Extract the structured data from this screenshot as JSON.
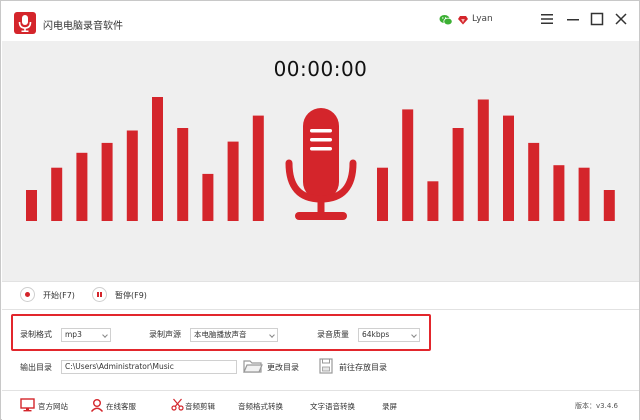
{
  "app": {
    "title": "闪电电脑录音软件",
    "user": "Lyan",
    "accent_color": "#d4252b",
    "icons": {
      "logo": "microphone-icon",
      "wechat": "wechat-icon",
      "vip": "diamond-icon",
      "menu": "hamburger-menu-icon",
      "minimize": "minimize-icon",
      "maximize": "maximize-icon",
      "close": "close-icon"
    }
  },
  "recorder": {
    "timer": "00:00:00",
    "level_bars_left": [
      0.25,
      0.43,
      0.55,
      0.63,
      0.73,
      1.0,
      0.75,
      0.38,
      0.64,
      0.85
    ],
    "level_bars_right": [
      0.43,
      0.9,
      0.32,
      0.75,
      0.98,
      0.85,
      0.63,
      0.45,
      0.43,
      0.25
    ]
  },
  "controls": {
    "start_label": "开始(F7)",
    "pause_label": "暂停(F9)"
  },
  "settings": {
    "format_label": "录制格式",
    "format_value": "mp3",
    "source_label": "录制声源",
    "source_value": "本电脑播放声音",
    "quality_label": "录音质量",
    "quality_value": "64kbps"
  },
  "output": {
    "dir_label": "输出目录",
    "dir_value": "C:\\Users\\Administrator\\Music",
    "change_label": "更改目录",
    "open_label": "前往存放目录"
  },
  "footer": {
    "items": [
      {
        "label": "官方网站",
        "icon": "monitor-icon"
      },
      {
        "label": "在线客服",
        "icon": "customer-service-icon"
      },
      {
        "label": "音频剪辑",
        "icon": "scissors-icon"
      },
      {
        "label": "音频格式转换",
        "icon": ""
      },
      {
        "label": "文字语音转换",
        "icon": ""
      },
      {
        "label": "录屏",
        "icon": ""
      }
    ],
    "version": "版本：v3.4.6"
  }
}
